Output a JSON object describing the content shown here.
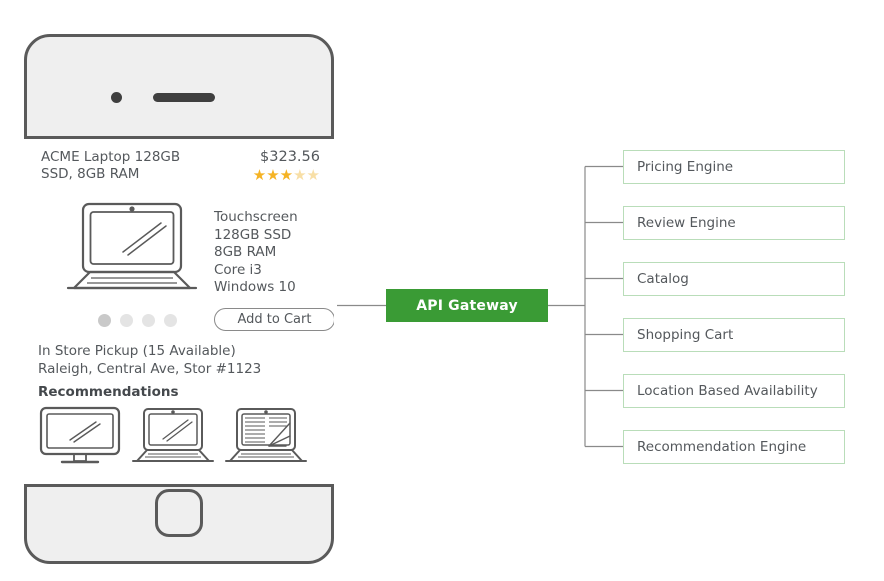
{
  "diagram": {
    "title": "Mobile commerce app backed by an API Gateway fronting six backend services",
    "colors": {
      "gateway_fill": "#3a9b35",
      "gateway_text": "#ffffff",
      "service_border": "#b9ddb9",
      "service_fill": "#ffffff",
      "connector": "#8a8a8a",
      "device_outline": "#5a5a5a",
      "device_body": "#efefef",
      "text": "#54585c",
      "star_filled": "#f5b324",
      "star_empty": "#f8dfa6"
    }
  },
  "phone": {
    "name": "smartphone-mockup",
    "speaker_icon": "speaker-grill-icon",
    "camera_icon": "front-camera-icon",
    "home_button": "home-button"
  },
  "product": {
    "title": "ACME Laptop 128GB SSD, 8GB RAM",
    "price": "$323.56",
    "rating": {
      "filled": 3,
      "total": 5,
      "filled_glyph": "★",
      "empty_glyph": "☆"
    },
    "image_icon": "laptop-icon",
    "specs": [
      "Touchscreen",
      "128GB SSD",
      "8GB RAM",
      "Core i3",
      "Windows 10"
    ],
    "carousel_dots": 4,
    "carousel_active_index": 0,
    "add_to_cart_label": "Add to Cart",
    "availability_line1": "In Store Pickup (15 Available)",
    "availability_line2": "Raleigh, Central Ave, Stor #1123"
  },
  "recommendations": {
    "heading": "Recommendations",
    "items": [
      {
        "icon": "desktop-monitor-icon"
      },
      {
        "icon": "laptop-icon"
      },
      {
        "icon": "laptop-with-text-icon"
      }
    ]
  },
  "gateway": {
    "label": "API Gateway"
  },
  "services": [
    {
      "label": "Pricing Engine"
    },
    {
      "label": "Review Engine"
    },
    {
      "label": "Catalog"
    },
    {
      "label": "Shopping Cart"
    },
    {
      "label": "Location Based Availability"
    },
    {
      "label": "Recommendation Engine"
    }
  ]
}
